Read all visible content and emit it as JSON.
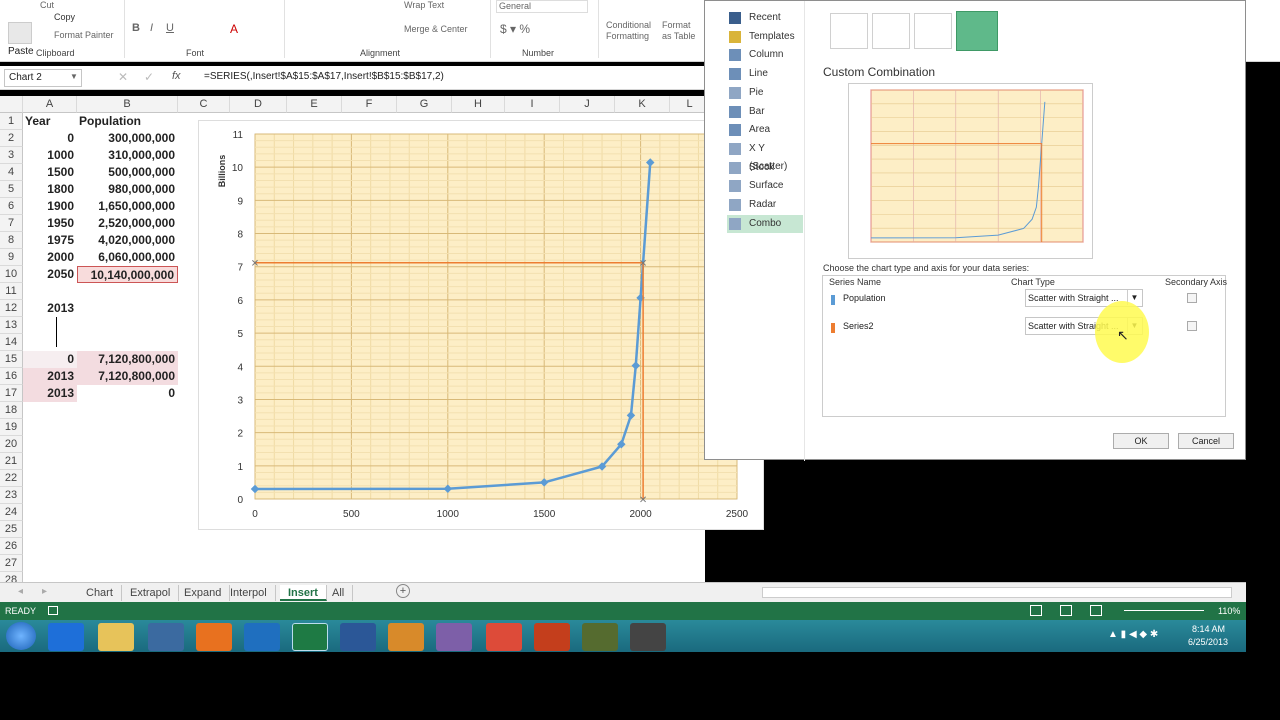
{
  "ribbon": {
    "clipboard": {
      "cut": "Cut",
      "copy": "Copy",
      "paste": "Paste",
      "format_painter": "Format Painter",
      "group": "Clipboard"
    },
    "font_group": "Font",
    "alignment": {
      "wrap": "Wrap Text",
      "merge": "Merge & Center",
      "group": "Alignment"
    },
    "number": {
      "format": "General",
      "group": "Number"
    },
    "styles": {
      "conditional": "Conditional Formatting",
      "format_table": "Format as Table"
    }
  },
  "formula_bar": {
    "name_box": "Chart 2",
    "fx": "fx",
    "formula": "=SERIES(,Insert!$A$15:$A$17,Insert!$B$15:$B$17,2)"
  },
  "columns": [
    "A",
    "B",
    "C",
    "D",
    "E",
    "F",
    "G",
    "H",
    "I",
    "J",
    "K",
    "L"
  ],
  "rows": [
    "1",
    "2",
    "3",
    "4",
    "5",
    "6",
    "7",
    "8",
    "9",
    "10",
    "11",
    "12",
    "13",
    "14",
    "15",
    "16",
    "17",
    "18",
    "19",
    "20",
    "21",
    "22",
    "23",
    "24",
    "25",
    "26",
    "27",
    "28"
  ],
  "sheet": {
    "header_a": "Year",
    "header_b": "Population",
    "data": [
      {
        "a": "0",
        "b": "300,000,000"
      },
      {
        "a": "1000",
        "b": "310,000,000"
      },
      {
        "a": "1500",
        "b": "500,000,000"
      },
      {
        "a": "1800",
        "b": "980,000,000"
      },
      {
        "a": "1900",
        "b": "1,650,000,000"
      },
      {
        "a": "1950",
        "b": "2,520,000,000"
      },
      {
        "a": "1975",
        "b": "4,020,000,000"
      },
      {
        "a": "2000",
        "b": "6,060,000,000"
      },
      {
        "a": "2050",
        "b": "10,140,000,000"
      }
    ],
    "a12": "2013",
    "series2": [
      {
        "a": "0",
        "b": "7,120,800,000"
      },
      {
        "a": "2013",
        "b": "7,120,800,000"
      },
      {
        "a": "2013",
        "b": "0"
      }
    ]
  },
  "chart_data": {
    "type": "scatter",
    "ylabel": "Billions",
    "xlim": [
      0,
      2500
    ],
    "ylim": [
      0,
      11
    ],
    "x_ticks": [
      "0",
      "500",
      "1000",
      "1500",
      "2000",
      "2500"
    ],
    "y_ticks": [
      "0",
      "1",
      "2",
      "3",
      "4",
      "5",
      "6",
      "7",
      "8",
      "9",
      "10",
      "11"
    ],
    "grid": true,
    "series": [
      {
        "name": "Population",
        "color": "#5b9bd5",
        "points": [
          [
            0,
            0.3
          ],
          [
            1000,
            0.31
          ],
          [
            1500,
            0.5
          ],
          [
            1800,
            0.98
          ],
          [
            1900,
            1.65
          ],
          [
            1950,
            2.52
          ],
          [
            1975,
            4.02
          ],
          [
            2000,
            6.06
          ],
          [
            2050,
            10.14
          ]
        ]
      },
      {
        "name": "Series2",
        "color": "#ed7d31",
        "points": [
          [
            0,
            7.1208
          ],
          [
            2013,
            7.1208
          ],
          [
            2013,
            0
          ]
        ]
      }
    ]
  },
  "dialog": {
    "chart_types": [
      "Recent",
      "Templates",
      "Column",
      "Line",
      "Pie",
      "Bar",
      "Area",
      "X Y (Scatter)",
      "Stock",
      "Surface",
      "Radar",
      "Combo"
    ],
    "selected": "Combo",
    "heading": "Custom Combination",
    "instruction": "Choose the chart type and axis for your data series:",
    "col_series": "Series Name",
    "col_type": "Chart Type",
    "col_secondary": "Secondary Axis",
    "series_rows": [
      {
        "name": "Population",
        "type": "Scatter with Straight ...",
        "color": "#5b9bd5"
      },
      {
        "name": "Series2",
        "type": "Scatter with Straight ...",
        "color": "#ed7d31"
      }
    ],
    "ok": "OK",
    "cancel": "Cancel"
  },
  "tabs": [
    "Chart",
    "Extrapol",
    "Expand",
    "Interpol",
    "Insert",
    "All"
  ],
  "active_tab": "Insert",
  "status": {
    "ready": "READY",
    "zoom": "110%"
  },
  "clock": {
    "time": "8:14 AM",
    "date": "6/25/2013"
  }
}
